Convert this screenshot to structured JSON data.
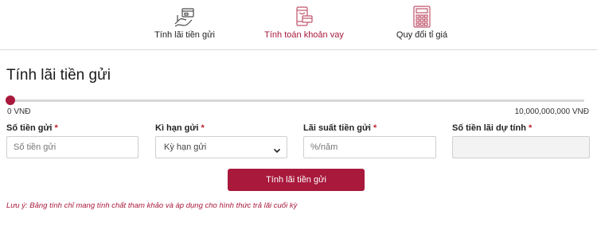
{
  "colors": {
    "accent": "#a8193c",
    "required": "#c0202a",
    "border": "#cfcfcf",
    "readonly_bg": "#f3f3f3"
  },
  "nav": {
    "items": [
      {
        "label": "Tính lãi tiền gửi",
        "icon": "savings-hand-card-icon",
        "active": false
      },
      {
        "label": "Tính toán khoản vay",
        "icon": "loan-phone-card-icon",
        "active": true
      },
      {
        "label": "Quy đổi tỉ giá",
        "icon": "calculator-icon",
        "active": false
      }
    ]
  },
  "page": {
    "title": "Tính lãi tiền gửi"
  },
  "slider": {
    "min_label": "0 VNĐ",
    "max_label": "10,000,000,000 VNĐ",
    "value_fraction": 0
  },
  "form": {
    "amount": {
      "label": "Số tiền gửi",
      "placeholder": "Số tiền gửi"
    },
    "term": {
      "label": "Kì hạn gửi",
      "selected": "Kỳ hạn gửi"
    },
    "rate": {
      "label": "Lãi suất tiền gửi",
      "placeholder": "%/năm"
    },
    "result": {
      "label": "Số tiền lãi dự tính",
      "value": ""
    },
    "required_mark": "*"
  },
  "actions": {
    "calculate_label": "Tính lãi tiền gửi"
  },
  "note": "Lưu ý: Bảng tính chỉ mang tính chất tham khảo và áp dụng cho hình thức trả lãi cuối kỳ"
}
